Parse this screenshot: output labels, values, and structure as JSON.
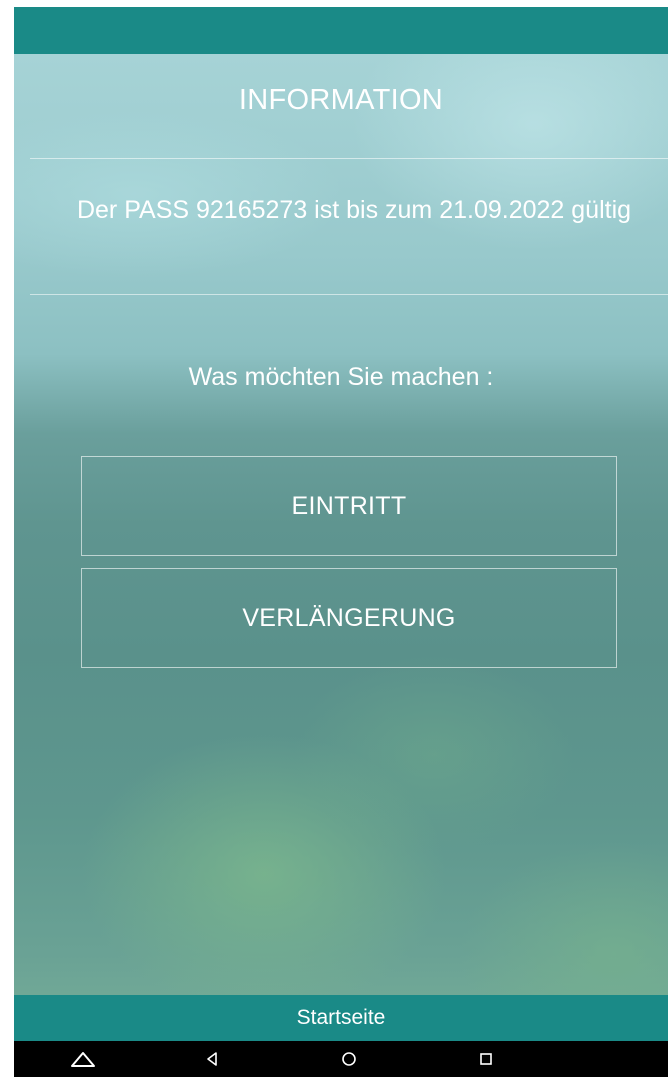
{
  "header": {
    "title": "INFORMATION"
  },
  "info": {
    "message": "Der PASS 92165273 ist bis zum 21.09.2022 gültig"
  },
  "prompt": {
    "question": "Was möchten Sie machen :"
  },
  "actions": {
    "entry_label": "EINTRITT",
    "renewal_label": "VERLÄNGERUNG"
  },
  "footer": {
    "home_label": "Startseite"
  },
  "system_nav": {
    "icons": [
      "home-triangle-icon",
      "back-icon",
      "home-icon",
      "recents-icon"
    ]
  },
  "colors": {
    "primary": "#1a8a87",
    "text": "#ffffff",
    "nav_bar": "#000000"
  }
}
